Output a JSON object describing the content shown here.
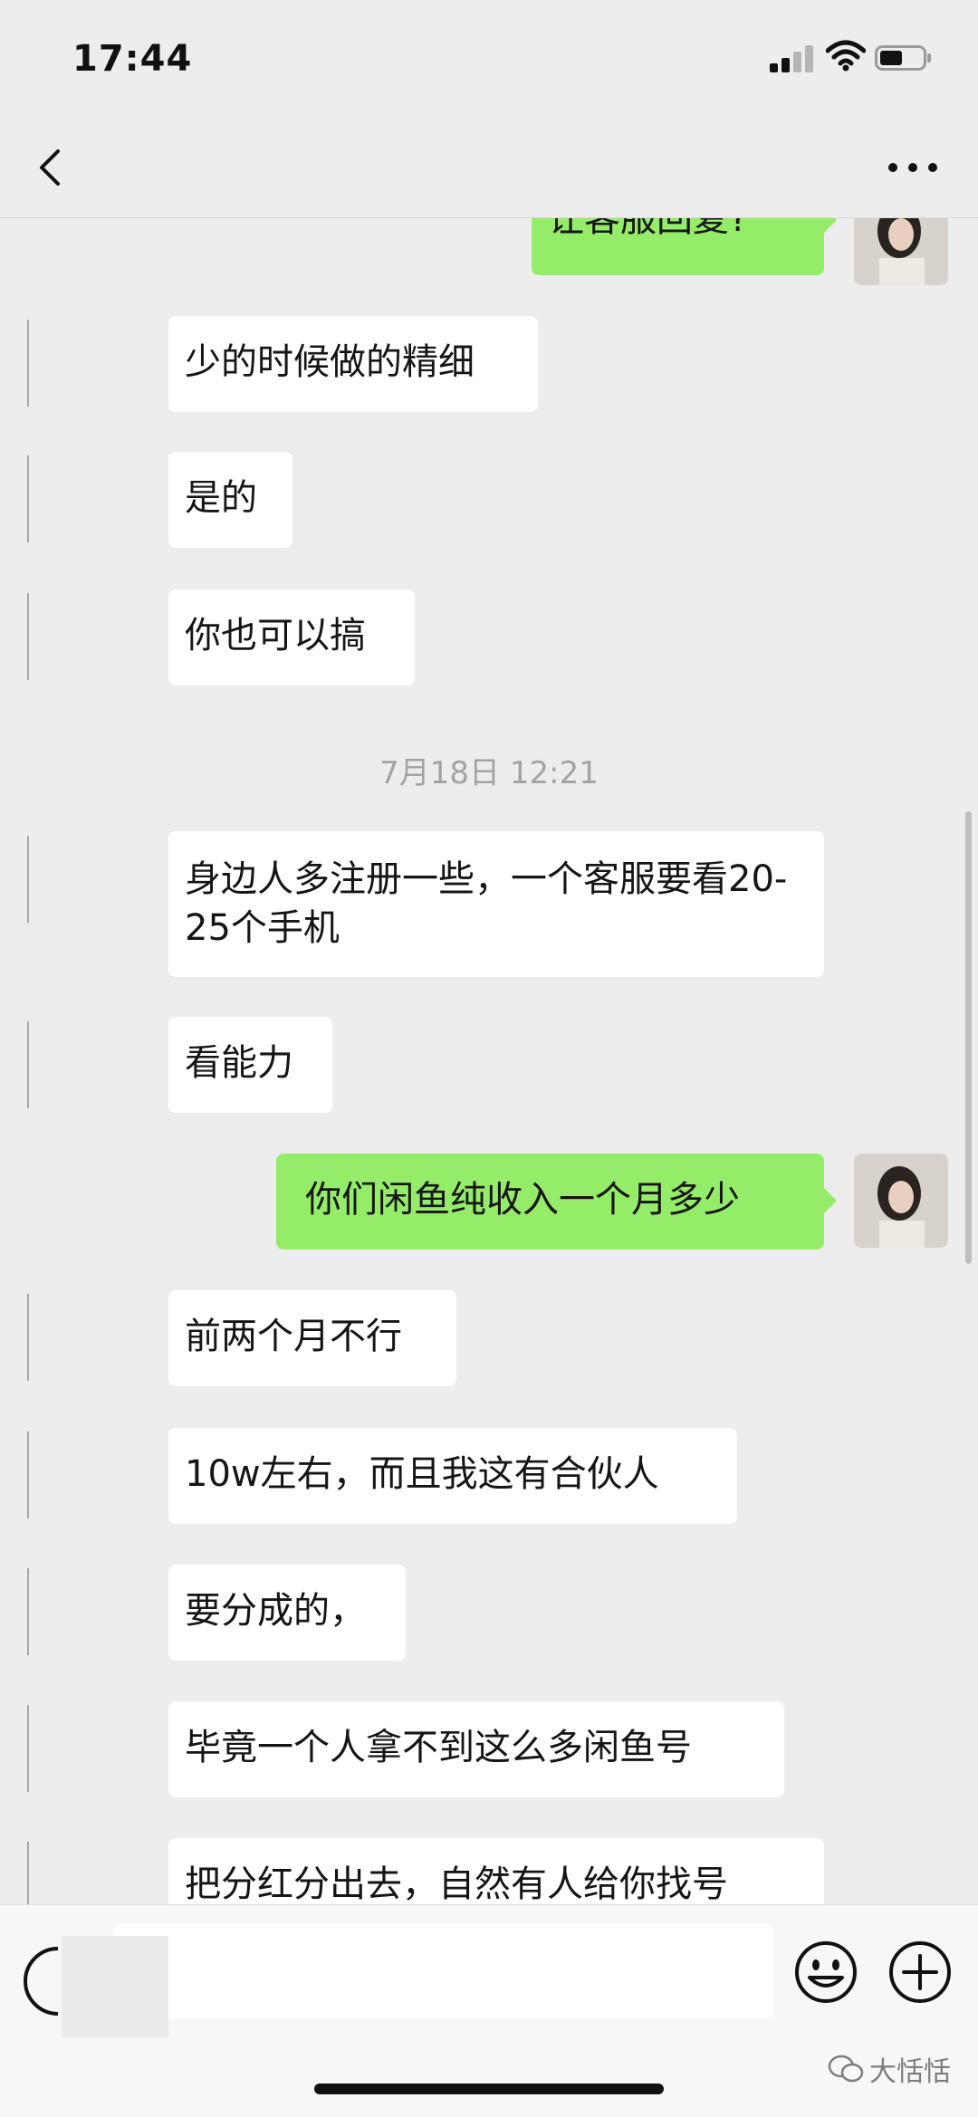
{
  "status_bar": {
    "time": "17:44"
  },
  "nav": {
    "back_icon": "chevron-left-icon",
    "more_icon": "more-dots-icon"
  },
  "messages": {
    "m0": "让客服回复?",
    "m1": "少的时候做的精细",
    "m2": "是的",
    "m3": "你也可以搞",
    "timestamp": "7月18日 12:21",
    "m4": "身边人多注册一些，一个客服要看20-25个手机",
    "m5": "看能力",
    "m6": "你们闲鱼纯收入一个月多少",
    "m7": "前两个月不行",
    "m8": "10w左右，而且我这有合伙人",
    "m9": "要分成的，",
    "m10": "毕竟一个人拿不到这么多闲鱼号",
    "m11": "把分红分出去，自然有人给你找号"
  },
  "input_bar": {
    "voice_icon": "voice-icon",
    "emoji_icon": "emoji-icon",
    "plus_icon": "plus-icon"
  },
  "watermark": {
    "text": "大恬恬"
  },
  "colors": {
    "background": "#ededed",
    "outgoing_bubble": "#95ec69",
    "incoming_bubble": "#ffffff",
    "timestamp": "#a3a3a3"
  }
}
